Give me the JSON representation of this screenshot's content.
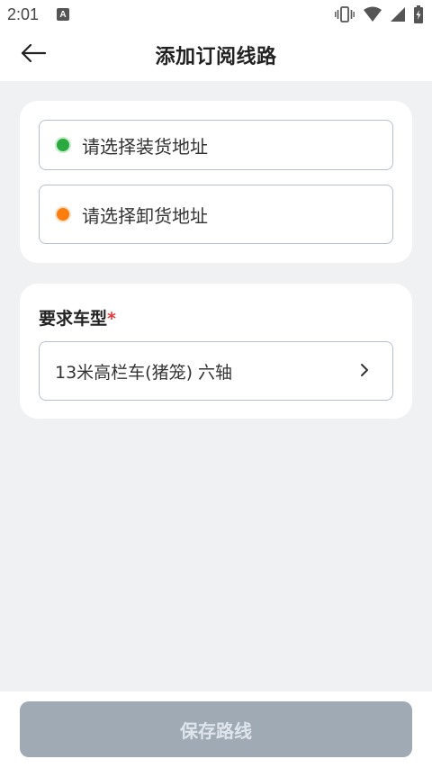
{
  "status_bar": {
    "time": "2:01",
    "notification_letter": "A",
    "icons": [
      "vibrate-icon",
      "wifi-icon",
      "signal-icon",
      "battery-charging-icon"
    ]
  },
  "header": {
    "title": "添加订阅线路",
    "back_icon": "arrow-left-icon"
  },
  "address": {
    "load_placeholder": "请选择装货地址",
    "unload_placeholder": "请选择卸货地址",
    "load_dot_color": "#2aaa3e",
    "unload_dot_color": "#fb7d0e"
  },
  "vehicle": {
    "label": "要求车型",
    "required_mark": "*",
    "value": "13米高栏车(猪笼) 六轴",
    "chevron": "›"
  },
  "footer": {
    "save_label": "保存路线",
    "save_color": "#9faab5"
  }
}
